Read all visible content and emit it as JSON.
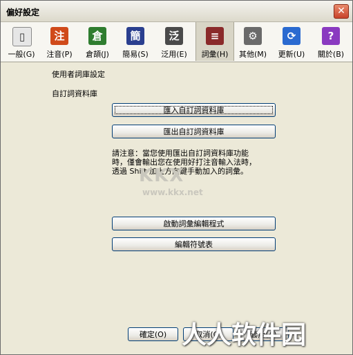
{
  "window": {
    "title": "偏好設定",
    "close_glyph": "✕"
  },
  "toolbar": {
    "items": [
      {
        "label": "一般(G)",
        "icon": "general-icon",
        "glyph": "▯",
        "color": "#e6e6e6"
      },
      {
        "label": "注音(P)",
        "icon": "zhuyin-icon",
        "glyph": "注",
        "color": "#d04a1a"
      },
      {
        "label": "倉頡(J)",
        "icon": "cangjie-icon",
        "glyph": "倉",
        "color": "#2f7d2f"
      },
      {
        "label": "簡易(S)",
        "icon": "simple-icon",
        "glyph": "簡",
        "color": "#2a3f8f"
      },
      {
        "label": "泛用(E)",
        "icon": "generic-icon",
        "glyph": "泛",
        "color": "#4a4a4a"
      },
      {
        "label": "詞彙(H)",
        "icon": "database-icon",
        "glyph": "≡",
        "color": "#8a2a2a"
      },
      {
        "label": "其他(M)",
        "icon": "gear-icon",
        "glyph": "⚙",
        "color": "#6a6a6a"
      },
      {
        "label": "更新(U)",
        "icon": "update-icon",
        "glyph": "⟳",
        "color": "#2a6ad0"
      },
      {
        "label": "關於(B)",
        "icon": "about-icon",
        "glyph": "?",
        "color": "#8a3ac0"
      }
    ],
    "active_index": 5
  },
  "content": {
    "section_title": "使用者詞庫設定",
    "subsection_title": "自訂詞資料庫",
    "import_button": "匯入自訂詞資料庫",
    "export_button": "匯出自訂詞資料庫",
    "note_line1": "請注意：當您使用匯出自訂詞資料庫功能",
    "note_line2": "時，僅會輸出您在使用好打注音輸入法時，",
    "note_line3": "透過 Shift 加上方向鍵手動加入的詞彙。",
    "watermark": "KKX",
    "watermark_url": "www.kkx.net",
    "editor_button": "啟動詞彙編輯程式",
    "symbol_button": "編輯符號表"
  },
  "footer": {
    "ok_button": "確定(O)",
    "cancel_button": "取消(C)",
    "apply_button": "套用(A)"
  },
  "overlay": {
    "brand_watermark": "人人软件园"
  }
}
